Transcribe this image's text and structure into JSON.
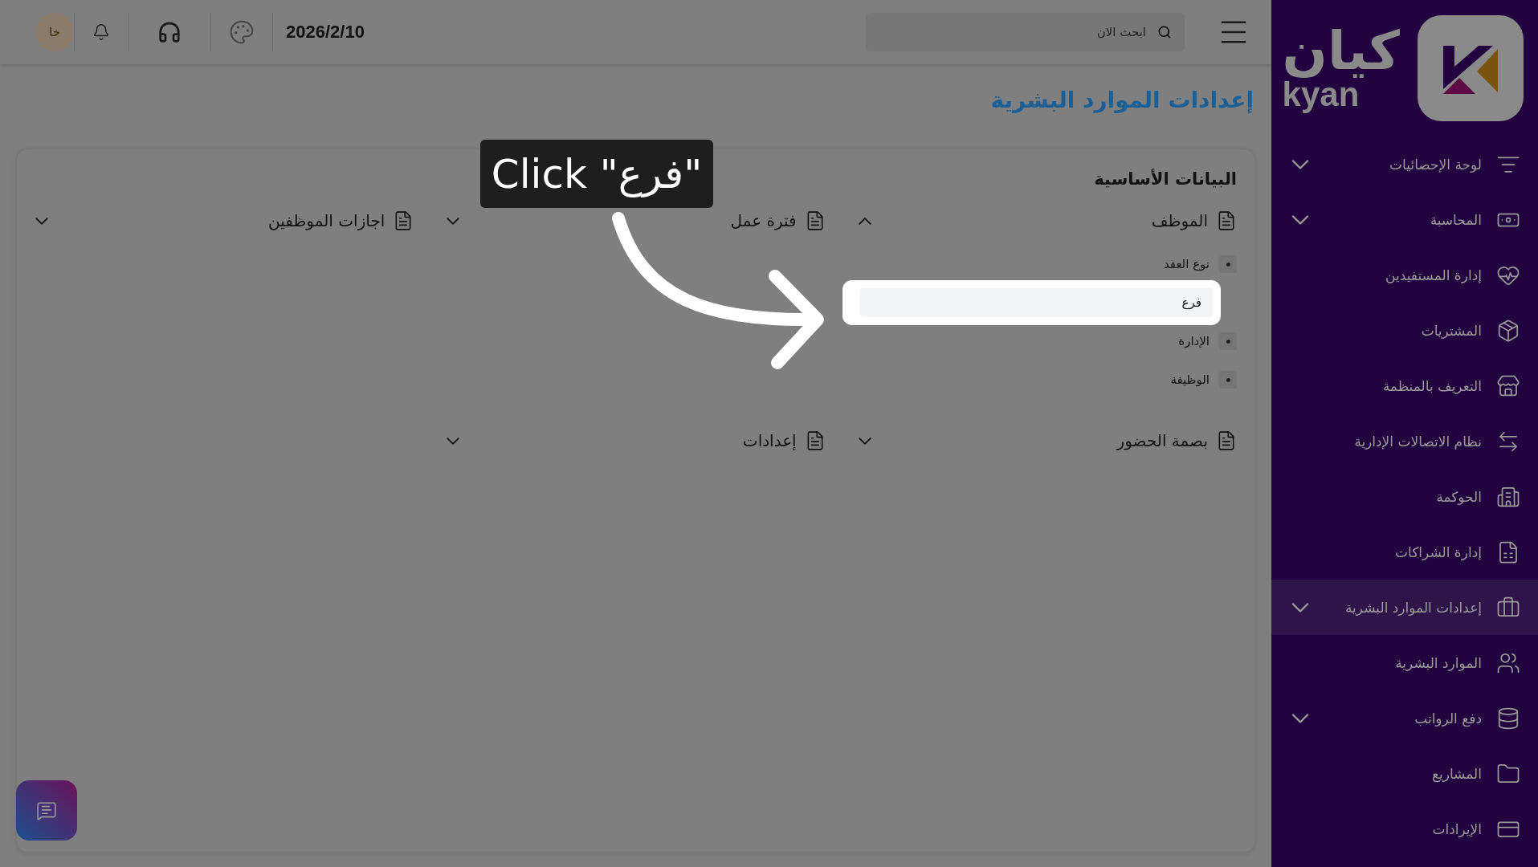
{
  "topbar": {
    "avatar": "خا",
    "date": "2026/2/10",
    "search": {
      "placeholder": "ابحث الان"
    }
  },
  "sidebar": {
    "logo": {
      "arabic": "كيان",
      "latin": "kyan"
    },
    "items": [
      {
        "label": "لوحة الإحصائيات",
        "expandable": true,
        "selected": false
      },
      {
        "label": "المحاسبة",
        "expandable": true,
        "selected": false
      },
      {
        "label": "إدارة المستفيدين",
        "expandable": false,
        "selected": false
      },
      {
        "label": "المشتريات",
        "expandable": false,
        "selected": false
      },
      {
        "label": "التعريف بالمنظمة",
        "expandable": false,
        "selected": false
      },
      {
        "label": "نظام الاتصالات الإدارية",
        "expandable": false,
        "selected": false
      },
      {
        "label": "الحوكمة",
        "expandable": false,
        "selected": false
      },
      {
        "label": "إدارة الشراكات",
        "expandable": false,
        "selected": false
      },
      {
        "label": "إعدادات الموارد البشرية",
        "expandable": true,
        "selected": true
      },
      {
        "label": "الموارد البشرية",
        "expandable": false,
        "selected": false
      },
      {
        "label": "دفع الرواتب",
        "expandable": true,
        "selected": false
      },
      {
        "label": "المشاريع",
        "expandable": false,
        "selected": false
      },
      {
        "label": "الإيرادات",
        "expandable": false,
        "selected": false
      }
    ]
  },
  "page": {
    "title": "إعدادات الموارد البشرية"
  },
  "card": {
    "title": "البيانات الأساسية",
    "groups": [
      {
        "label": "الموظف",
        "expanded": true,
        "children": [
          {
            "label": "نوع العقد",
            "selected": false
          },
          {
            "label": "فرع",
            "selected": true
          },
          {
            "label": "الإدارة",
            "selected": false
          },
          {
            "label": "الوظيفة",
            "selected": false
          }
        ]
      },
      {
        "label": "فترة عمل",
        "expanded": false
      },
      {
        "label": "اجازات الموظفين",
        "expanded": false
      },
      {
        "label": "بصمة الحضور",
        "expanded": false
      },
      {
        "label": "إعدادات",
        "expanded": false
      }
    ]
  },
  "tutorial": {
    "callout": "Click \"فرع\""
  }
}
